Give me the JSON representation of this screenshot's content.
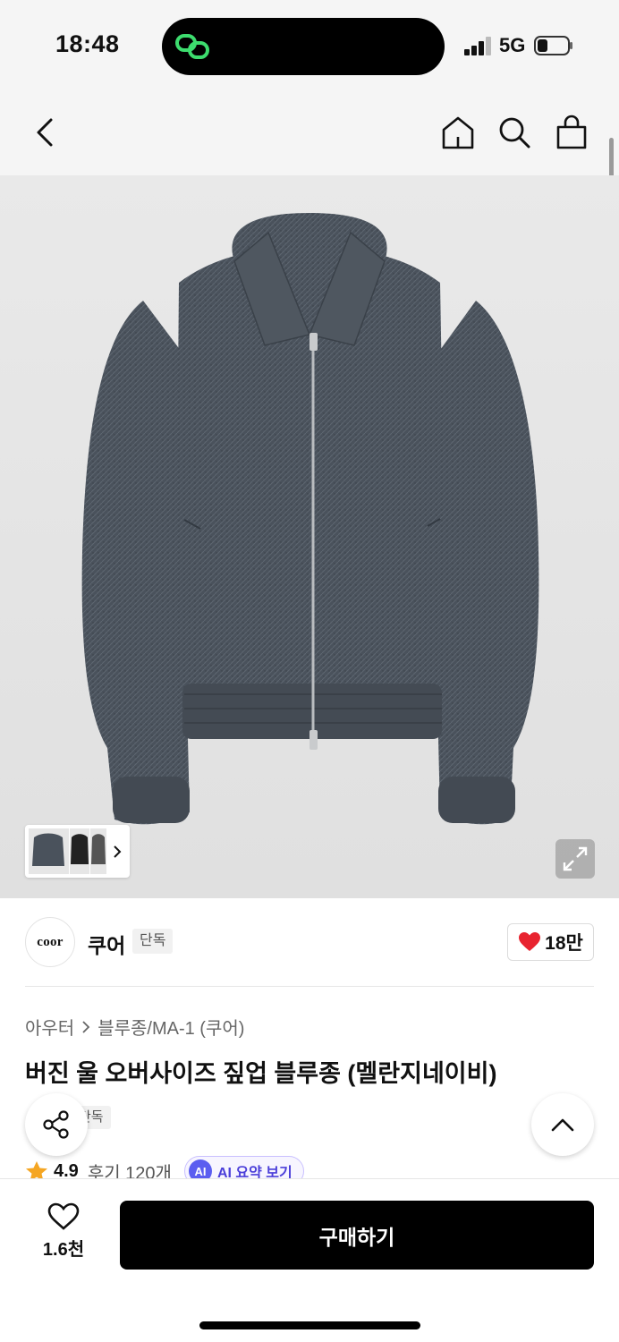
{
  "status_bar": {
    "time": "18:48",
    "network": "5G",
    "battery_icon": "battery-low-icon",
    "signal_icon": "cellular-signal-icon",
    "island_app_icon": "link-chain-icon",
    "island_app_color": "#3ddc6e"
  },
  "nav": {
    "back_icon": "chevron-left-icon",
    "home_icon": "home-icon",
    "search_icon": "search-icon",
    "cart_icon": "shopping-bag-icon"
  },
  "hero": {
    "image": "jacket-photo",
    "thumbnail_next_icon": "chevron-right-icon",
    "expand_icon": "expand-icon"
  },
  "brand": {
    "logo_text": "coor",
    "name": "쿠어",
    "tag": "단독",
    "like_icon": "heart-filled-icon",
    "like_count": "18만",
    "like_color": "#e8232f"
  },
  "product": {
    "breadcrumb": [
      "아우터",
      "블루종/MA-1 (쿠어)"
    ],
    "breadcrumb_separator_icon": "chevron-right-icon",
    "title": "버진 울 오버사이즈 짚업 블루종 (멜란지네이비)",
    "tag": "단독",
    "rating": "4.9",
    "rating_icon": "star-icon",
    "rating_color": "#f5a623",
    "reviews": "후기 120개",
    "ai_badge": "AI",
    "ai_label": "AI 요약 보기",
    "share_icon": "share-icon",
    "scroll_top_icon": "chevron-up-icon"
  },
  "bottom_bar": {
    "wish_icon": "heart-outline-icon",
    "wish_count": "1.6천",
    "buy_label": "구매하기"
  }
}
